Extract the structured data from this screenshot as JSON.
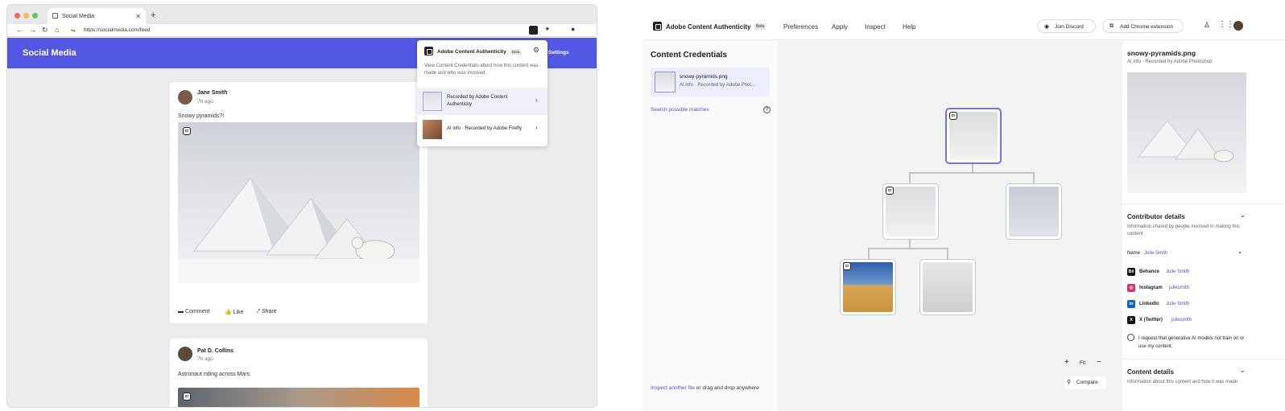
{
  "browser": {
    "tab_title": "Social Media",
    "url": "https://socialmedia.com/feed"
  },
  "social": {
    "app_title": "Social Media",
    "settings_label": "Settings",
    "posts": [
      {
        "author": "Jane Smith",
        "time": "7h ago",
        "text": "Snowy pyramids?!",
        "actions": [
          "Comment",
          "Like",
          "Share"
        ]
      },
      {
        "author": "Pat D. Collins",
        "time": "7h ago",
        "text": "Astronaut riding across Mars"
      }
    ]
  },
  "popup": {
    "title": "Adobe Content Authenticity",
    "beta": "Beta",
    "description": "View Content Credentials about how this content was made and who was involved.",
    "items": [
      {
        "label": "Recorded by Adobe Content Authenticity"
      },
      {
        "label": "AI info · Recorded by Adobe Firefly"
      }
    ]
  },
  "app": {
    "title": "Adobe Content Authenticity",
    "beta": "Beta",
    "menu": [
      "Preferences",
      "Apply",
      "Inspect",
      "Help"
    ],
    "join_discord": "Join Discord",
    "add_chrome": "Add Chrome extension"
  },
  "left_panel": {
    "heading": "Content Credentials",
    "file_name": "snowy-pyramids.png",
    "file_sub": "AI info · Recorded by Adobe Phot...",
    "search_matches": "Search possible matches",
    "inspect_link": "Inspect another file",
    "inspect_rest": " or drag and drop anywhere"
  },
  "canvas": {
    "fit_label": "Fit",
    "compare_label": "Compare"
  },
  "right_panel": {
    "file_name": "snowy-pyramids.png",
    "file_sub": "AI info · Recorded by Adobe Photoshop",
    "contributor_heading": "Contributor details",
    "contributor_desc": "Information shared by people involved in making this content",
    "name_label": "Name",
    "name_value": "Julie Smith",
    "socials": [
      {
        "platform": "Behance",
        "handle": "Julie Smith",
        "icon": "Bē",
        "color": "#111111"
      },
      {
        "platform": "Instagram",
        "handle": "juliesmith",
        "icon": "◎",
        "color": "#d6336c"
      },
      {
        "platform": "LinkedIn",
        "handle": "Julie Smith",
        "icon": "in",
        "color": "#0a66c2"
      },
      {
        "platform": "X (Twitter)",
        "handle": "juliesmith",
        "icon": "X",
        "color": "#111111"
      }
    ],
    "ai_request": "I request that generative AI models not train on or use my content.",
    "content_heading": "Content details",
    "content_desc": "Information about this content and how it was made"
  },
  "colors": {
    "accent": "#5258e4",
    "link": "#4c51d8"
  }
}
